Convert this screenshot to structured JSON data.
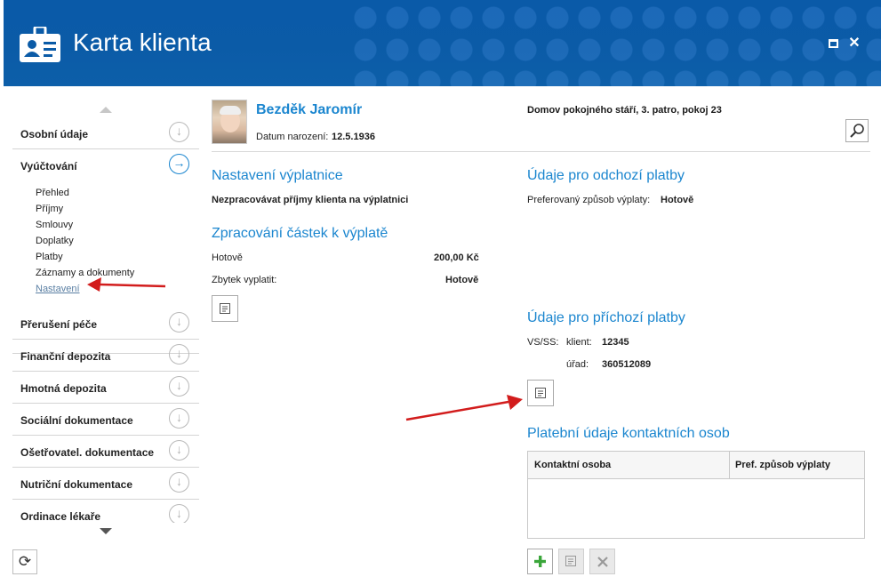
{
  "window": {
    "title": "Karta klienta",
    "icon": "client-card-icon",
    "maximize_icon": "maximize-icon",
    "close_icon": "close-icon",
    "close_glyph": "✕"
  },
  "sidebar": {
    "sections": [
      {
        "label": "Osobní údaje",
        "state": "collapsed"
      },
      {
        "label": "Vyúčtování",
        "state": "expanded"
      },
      {
        "label": "Přerušení péče",
        "state": "collapsed"
      },
      {
        "label": "Finanční depozita",
        "state": "collapsed"
      },
      {
        "label": "Hmotná depozita",
        "state": "collapsed"
      },
      {
        "label": "Sociální dokumentace",
        "state": "collapsed"
      },
      {
        "label": "Ošetřovatel. dokumentace",
        "state": "collapsed"
      },
      {
        "label": "Nutriční dokumentace",
        "state": "collapsed"
      },
      {
        "label": "Ordinace lékaře",
        "state": "collapsed"
      }
    ],
    "subitems": [
      "Přehled",
      "Příjmy",
      "Smlouvy",
      "Doplatky",
      "Platby",
      "Záznamy a dokumenty",
      "Nastavení"
    ],
    "current_subitem": "Nastavení",
    "collapsed_glyph": "↓",
    "expanded_glyph": "→",
    "refresh_glyph": "⟳"
  },
  "client": {
    "name": "Bezděk Jaromír",
    "dob_label": "Datum narození:",
    "dob_value": "12.5.1936",
    "location": "Domov pokojného stáří, 3. patro, pokoj 23"
  },
  "payout_settings": {
    "title": "Nastavení výplatnice",
    "text": "Nezpracovávat příjmy klienta na výplatnici"
  },
  "amount_processing": {
    "title": "Zpracování částek k výplatě",
    "rows": [
      {
        "label": "Hotově",
        "value": "200,00 Kč"
      },
      {
        "label": "Zbytek vyplatit:",
        "value": "Hotově"
      }
    ]
  },
  "outgoing": {
    "title": "Údaje pro odchozí platby",
    "label": "Preferovaný způsob výplaty:",
    "value": "Hotově"
  },
  "incoming": {
    "title": "Údaje pro příchozí platby",
    "vs_label": "VS/SS:",
    "client_label": "klient:",
    "client_value": "12345",
    "office_label": "úřad:",
    "office_value": "360512089"
  },
  "contacts": {
    "title": "Platební údaje kontaktních osob",
    "columns": [
      "Kontaktní osoba",
      "Pref. způsob výplaty"
    ],
    "rows": [],
    "add_icon": "plus-icon",
    "edit_icon": "edit-icon",
    "delete_icon": "delete-icon"
  },
  "colors": {
    "accent": "#1b86cf",
    "header_bg": "#0b5ba7",
    "add_green": "#3aa63a"
  }
}
